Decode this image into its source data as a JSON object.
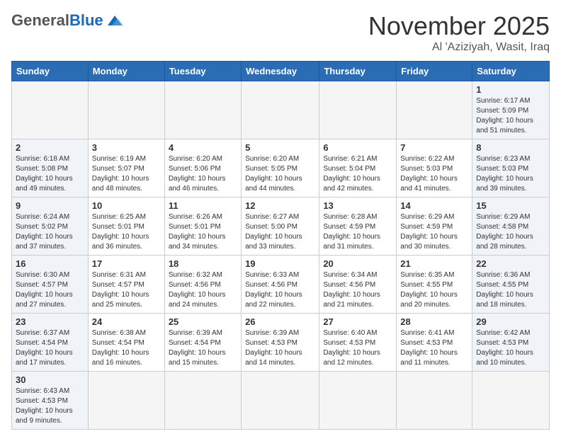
{
  "header": {
    "logo_general": "General",
    "logo_blue": "Blue",
    "month": "November 2025",
    "location": "Al 'Aziziyah, Wasit, Iraq"
  },
  "weekdays": [
    "Sunday",
    "Monday",
    "Tuesday",
    "Wednesday",
    "Thursday",
    "Friday",
    "Saturday"
  ],
  "weeks": [
    [
      {
        "day": "",
        "info": ""
      },
      {
        "day": "",
        "info": ""
      },
      {
        "day": "",
        "info": ""
      },
      {
        "day": "",
        "info": ""
      },
      {
        "day": "",
        "info": ""
      },
      {
        "day": "",
        "info": ""
      },
      {
        "day": "1",
        "info": "Sunrise: 6:17 AM\nSunset: 5:09 PM\nDaylight: 10 hours and 51 minutes."
      }
    ],
    [
      {
        "day": "2",
        "info": "Sunrise: 6:18 AM\nSunset: 5:08 PM\nDaylight: 10 hours and 49 minutes."
      },
      {
        "day": "3",
        "info": "Sunrise: 6:19 AM\nSunset: 5:07 PM\nDaylight: 10 hours and 48 minutes."
      },
      {
        "day": "4",
        "info": "Sunrise: 6:20 AM\nSunset: 5:06 PM\nDaylight: 10 hours and 46 minutes."
      },
      {
        "day": "5",
        "info": "Sunrise: 6:20 AM\nSunset: 5:05 PM\nDaylight: 10 hours and 44 minutes."
      },
      {
        "day": "6",
        "info": "Sunrise: 6:21 AM\nSunset: 5:04 PM\nDaylight: 10 hours and 42 minutes."
      },
      {
        "day": "7",
        "info": "Sunrise: 6:22 AM\nSunset: 5:03 PM\nDaylight: 10 hours and 41 minutes."
      },
      {
        "day": "8",
        "info": "Sunrise: 6:23 AM\nSunset: 5:03 PM\nDaylight: 10 hours and 39 minutes."
      }
    ],
    [
      {
        "day": "9",
        "info": "Sunrise: 6:24 AM\nSunset: 5:02 PM\nDaylight: 10 hours and 37 minutes."
      },
      {
        "day": "10",
        "info": "Sunrise: 6:25 AM\nSunset: 5:01 PM\nDaylight: 10 hours and 36 minutes."
      },
      {
        "day": "11",
        "info": "Sunrise: 6:26 AM\nSunset: 5:01 PM\nDaylight: 10 hours and 34 minutes."
      },
      {
        "day": "12",
        "info": "Sunrise: 6:27 AM\nSunset: 5:00 PM\nDaylight: 10 hours and 33 minutes."
      },
      {
        "day": "13",
        "info": "Sunrise: 6:28 AM\nSunset: 4:59 PM\nDaylight: 10 hours and 31 minutes."
      },
      {
        "day": "14",
        "info": "Sunrise: 6:29 AM\nSunset: 4:59 PM\nDaylight: 10 hours and 30 minutes."
      },
      {
        "day": "15",
        "info": "Sunrise: 6:29 AM\nSunset: 4:58 PM\nDaylight: 10 hours and 28 minutes."
      }
    ],
    [
      {
        "day": "16",
        "info": "Sunrise: 6:30 AM\nSunset: 4:57 PM\nDaylight: 10 hours and 27 minutes."
      },
      {
        "day": "17",
        "info": "Sunrise: 6:31 AM\nSunset: 4:57 PM\nDaylight: 10 hours and 25 minutes."
      },
      {
        "day": "18",
        "info": "Sunrise: 6:32 AM\nSunset: 4:56 PM\nDaylight: 10 hours and 24 minutes."
      },
      {
        "day": "19",
        "info": "Sunrise: 6:33 AM\nSunset: 4:56 PM\nDaylight: 10 hours and 22 minutes."
      },
      {
        "day": "20",
        "info": "Sunrise: 6:34 AM\nSunset: 4:56 PM\nDaylight: 10 hours and 21 minutes."
      },
      {
        "day": "21",
        "info": "Sunrise: 6:35 AM\nSunset: 4:55 PM\nDaylight: 10 hours and 20 minutes."
      },
      {
        "day": "22",
        "info": "Sunrise: 6:36 AM\nSunset: 4:55 PM\nDaylight: 10 hours and 18 minutes."
      }
    ],
    [
      {
        "day": "23",
        "info": "Sunrise: 6:37 AM\nSunset: 4:54 PM\nDaylight: 10 hours and 17 minutes."
      },
      {
        "day": "24",
        "info": "Sunrise: 6:38 AM\nSunset: 4:54 PM\nDaylight: 10 hours and 16 minutes."
      },
      {
        "day": "25",
        "info": "Sunrise: 6:39 AM\nSunset: 4:54 PM\nDaylight: 10 hours and 15 minutes."
      },
      {
        "day": "26",
        "info": "Sunrise: 6:39 AM\nSunset: 4:53 PM\nDaylight: 10 hours and 14 minutes."
      },
      {
        "day": "27",
        "info": "Sunrise: 6:40 AM\nSunset: 4:53 PM\nDaylight: 10 hours and 12 minutes."
      },
      {
        "day": "28",
        "info": "Sunrise: 6:41 AM\nSunset: 4:53 PM\nDaylight: 10 hours and 11 minutes."
      },
      {
        "day": "29",
        "info": "Sunrise: 6:42 AM\nSunset: 4:53 PM\nDaylight: 10 hours and 10 minutes."
      }
    ],
    [
      {
        "day": "30",
        "info": "Sunrise: 6:43 AM\nSunset: 4:53 PM\nDaylight: 10 hours and 9 minutes."
      },
      {
        "day": "",
        "info": ""
      },
      {
        "day": "",
        "info": ""
      },
      {
        "day": "",
        "info": ""
      },
      {
        "day": "",
        "info": ""
      },
      {
        "day": "",
        "info": ""
      },
      {
        "day": "",
        "info": ""
      }
    ]
  ]
}
